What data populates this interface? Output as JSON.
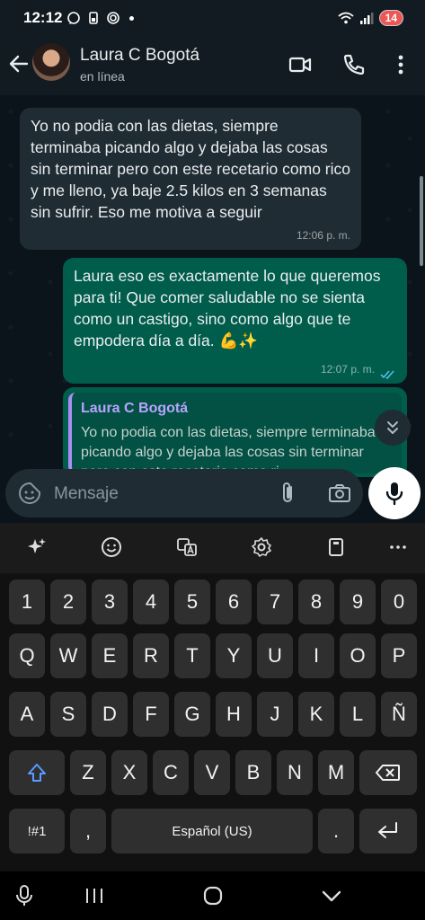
{
  "status_bar": {
    "time": "12:12",
    "battery": "14"
  },
  "header": {
    "contact_name": "Laura C Bogotá",
    "contact_status": "en línea"
  },
  "messages": [
    {
      "direction": "incoming",
      "text": "Yo no podia con las dietas, siempre terminaba picando algo y dejaba las cosas sin terminar pero con este recetario como rico y me lleno, ya baje 2.5 kilos en 3 semanas sin sufrir. Eso me motiva a seguir",
      "time": "12:06 p. m."
    },
    {
      "direction": "outgoing",
      "text": "Laura eso es exactamente lo que queremos para ti! Que comer saludable no se sienta como un castigo, sino como algo que te empodera día a día. 💪✨",
      "time": "12:07 p. m."
    },
    {
      "direction": "outgoing",
      "quoted_name": "Laura C Bogotá",
      "quoted_text": "Yo no podia con las dietas, siempre terminaba picando algo y dejaba las cosas sin terminar pero con este recetario como ri"
    }
  ],
  "input": {
    "placeholder": "Mensaje"
  },
  "keyboard": {
    "row_numbers": [
      "1",
      "2",
      "3",
      "4",
      "5",
      "6",
      "7",
      "8",
      "9",
      "0"
    ],
    "row_1": [
      "Q",
      "W",
      "E",
      "R",
      "T",
      "Y",
      "U",
      "I",
      "O",
      "P"
    ],
    "row_2": [
      "A",
      "S",
      "D",
      "F",
      "G",
      "H",
      "J",
      "K",
      "L",
      "Ñ"
    ],
    "row_3": [
      "Z",
      "X",
      "C",
      "V",
      "B",
      "N",
      "M"
    ],
    "symbols_key": "!#1",
    "comma_key": ",",
    "space_label": "Español (US)",
    "period_key": "."
  },
  "colors": {
    "incoming_bubble": "#202c33",
    "outgoing_bubble": "#005c4b",
    "background": "#0b141a",
    "accent": "#53bdeb"
  }
}
